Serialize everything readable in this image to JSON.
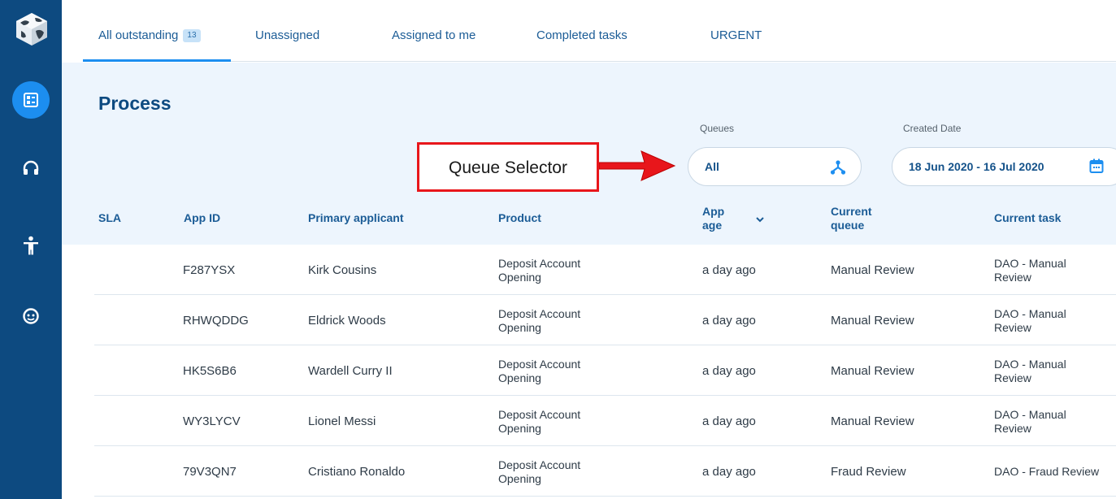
{
  "sidebar": {
    "logo": "globe-cube-logo",
    "items": [
      {
        "icon": "dashboard-icon",
        "active": true
      },
      {
        "icon": "headset-icon",
        "active": false
      },
      {
        "icon": "accessibility-icon",
        "active": false
      },
      {
        "icon": "face-icon",
        "active": false
      }
    ]
  },
  "tabs": [
    {
      "label": "All outstanding",
      "badge": "13",
      "active": true
    },
    {
      "label": "Unassigned"
    },
    {
      "label": "Assigned to me"
    },
    {
      "label": "Completed tasks"
    },
    {
      "label": "URGENT"
    }
  ],
  "page": {
    "title": "Process"
  },
  "filters": {
    "queues_label": "Queues",
    "queues_value": "All",
    "queues_icon": "hierarchy-icon",
    "created_label": "Created Date",
    "created_value": "18 Jun 2020 - 16 Jul 2020",
    "created_icon": "calendar-icon"
  },
  "annotation": {
    "text": "Queue Selector",
    "color": "#e8161b"
  },
  "table": {
    "columns": {
      "sla": "SLA",
      "app_id": "App ID",
      "applicant": "Primary applicant",
      "product": "Product",
      "age_1": "App",
      "age_2": "age",
      "queue_1": "Current",
      "queue_2": "queue",
      "task": "Current task"
    },
    "rows": [
      {
        "app_id": "F287YSX",
        "applicant": "Kirk Cousins",
        "product_1": "Deposit Account",
        "product_2": "Opening",
        "age": "a day ago",
        "queue": "Manual Review",
        "task_1": "DAO - Manual",
        "task_2": "Review"
      },
      {
        "app_id": "RHWQDDG",
        "applicant": "Eldrick Woods",
        "product_1": "Deposit Account",
        "product_2": "Opening",
        "age": "a day ago",
        "queue": "Manual Review",
        "task_1": "DAO - Manual",
        "task_2": "Review"
      },
      {
        "app_id": "HK5S6B6",
        "applicant": "Wardell Curry II",
        "product_1": "Deposit Account",
        "product_2": "Opening",
        "age": "a day ago",
        "queue": "Manual Review",
        "task_1": "DAO - Manual",
        "task_2": "Review"
      },
      {
        "app_id": "WY3LYCV",
        "applicant": "Lionel Messi",
        "product_1": "Deposit Account",
        "product_2": "Opening",
        "age": "a day ago",
        "queue": "Manual Review",
        "task_1": "DAO - Manual",
        "task_2": "Review"
      },
      {
        "app_id": "79V3QN7",
        "applicant": "Cristiano Ronaldo",
        "product_1": "Deposit Account",
        "product_2": "Opening",
        "age": "a day ago",
        "queue": "Fraud Review",
        "task_1": "DAO - Fraud Review",
        "task_2": ""
      }
    ]
  },
  "colors": {
    "sidebar": "#0d4a80",
    "accent": "#1c8ef0",
    "header_band": "#edf5fd",
    "heading": "#0d4a80",
    "annotation": "#e8161b"
  }
}
